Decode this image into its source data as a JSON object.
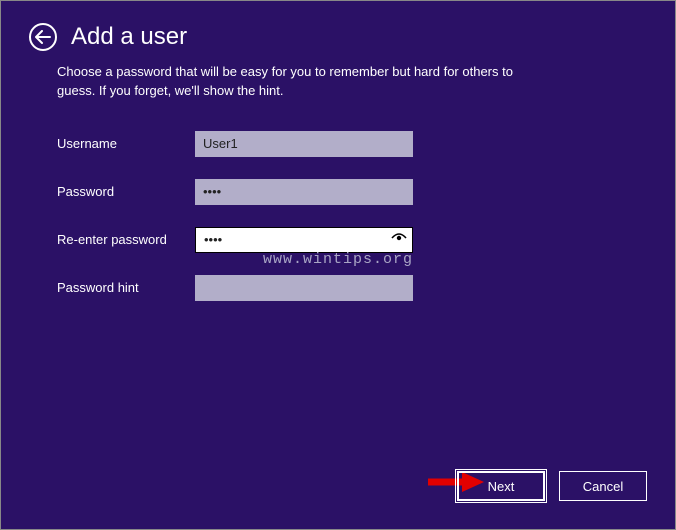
{
  "header": {
    "title": "Add a user"
  },
  "description": "Choose a password that will be easy for you to remember but hard for others to guess. If you forget, we'll show the hint.",
  "form": {
    "username": {
      "label": "Username",
      "value": "User1"
    },
    "password": {
      "label": "Password",
      "value": "••••"
    },
    "reenter": {
      "label": "Re-enter password",
      "value": "••••"
    },
    "hint": {
      "label": "Password hint",
      "value": ""
    }
  },
  "watermark": "www.wintips.org",
  "buttons": {
    "next": "Next",
    "cancel": "Cancel"
  },
  "icons": {
    "back": "back-arrow-icon",
    "eye": "reveal-password-icon"
  }
}
